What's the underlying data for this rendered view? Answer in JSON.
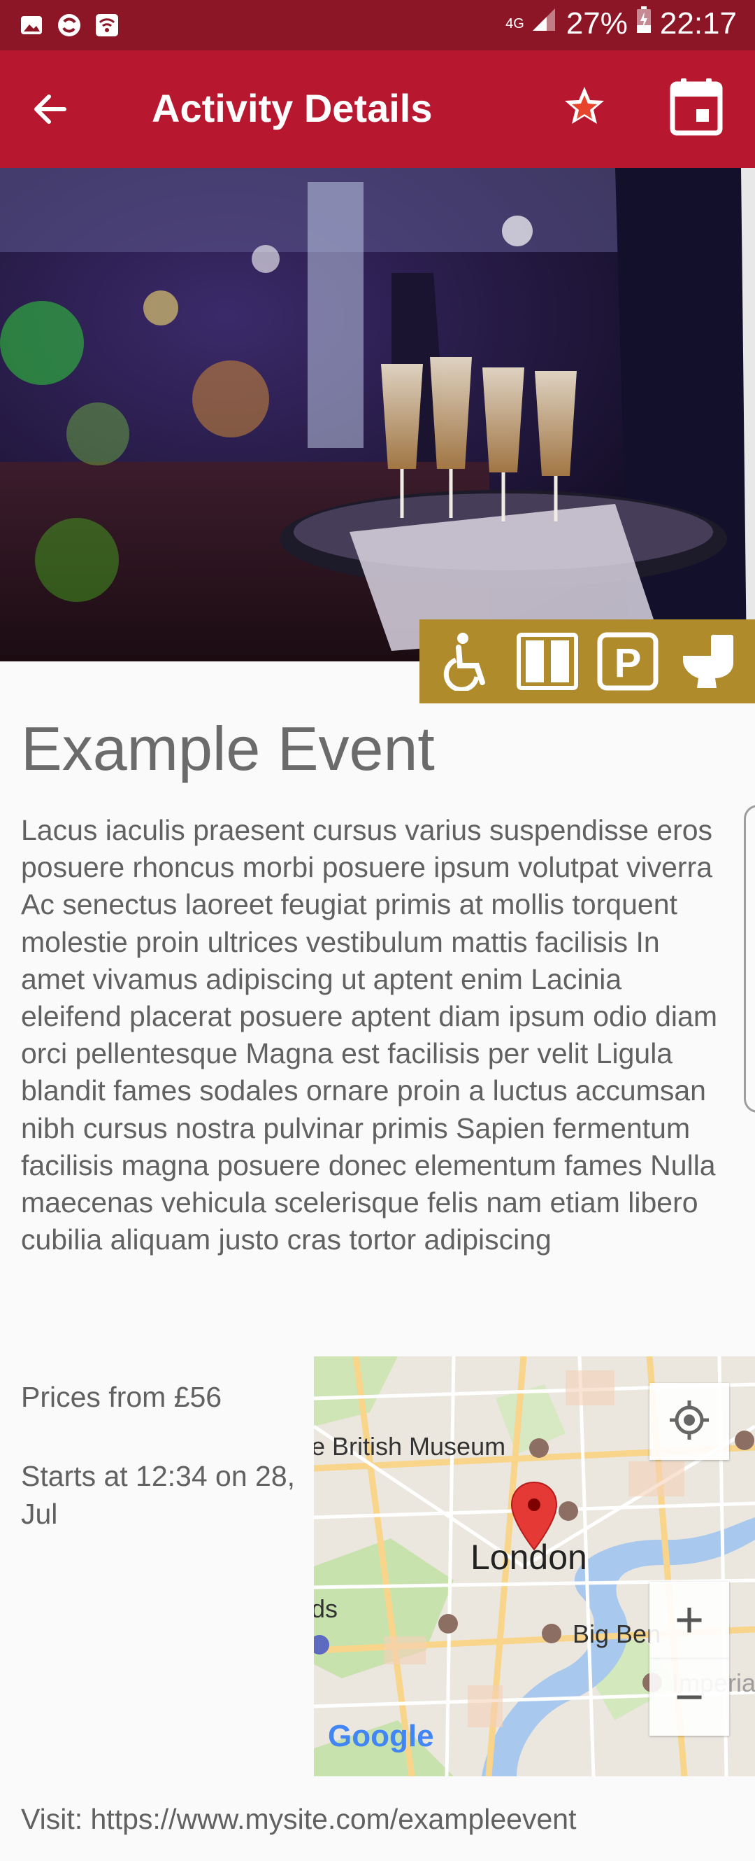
{
  "status_bar": {
    "network": "4G",
    "battery": "27%",
    "time": "22:17"
  },
  "app_bar": {
    "title": "Activity Details",
    "icons": [
      "back-arrow-icon",
      "star-icon",
      "calendar-icon"
    ]
  },
  "hero": {
    "description": "champagne-tray-event-photo",
    "amenities": [
      "wheelchair-access-icon",
      "door-icon",
      "parking-icon",
      "toilet-icon"
    ]
  },
  "event": {
    "title": "Example Event",
    "description": "Lacus iaculis praesent cursus varius suspendisse eros posuere rhoncus morbi posuere ipsum volutpat viverra Ac senectus laoreet feugiat primis at mollis torquent molestie proin ultrices vestibulum mattis facilisis In amet vivamus adipiscing ut aptent enim Lacinia eleifend placerat posuere aptent diam ipsum odio diam orci pellentesque Magna est facilisis per velit Ligula blandit fames sodales ornare proin a luctus accumsan nibh cursus nostra pulvinar primis Sapien fermentum facilisis magna posuere donec elementum fames Nulla maecenas vehicula scelerisque felis nam etiam libero cubilia aliquam justo cras tortor adipiscing",
    "prices": "Prices from £56",
    "starts": "Starts at 12:34 on 28, Jul",
    "visit": "Visit: https://www.mysite.com/exampleevent"
  },
  "map": {
    "labels": {
      "museum": "e British Museum",
      "city": "London",
      "big_ben": "Big Ben",
      "imperial": "Imperia",
      "left": "ds",
      "brand": "Google"
    },
    "controls": {
      "zoom_in": "+",
      "zoom_out": "−"
    }
  },
  "colors": {
    "status_bar": "#8c1526",
    "app_bar": "#b7182f",
    "amenities_bar": "#b08b2b",
    "text": "#616161"
  }
}
